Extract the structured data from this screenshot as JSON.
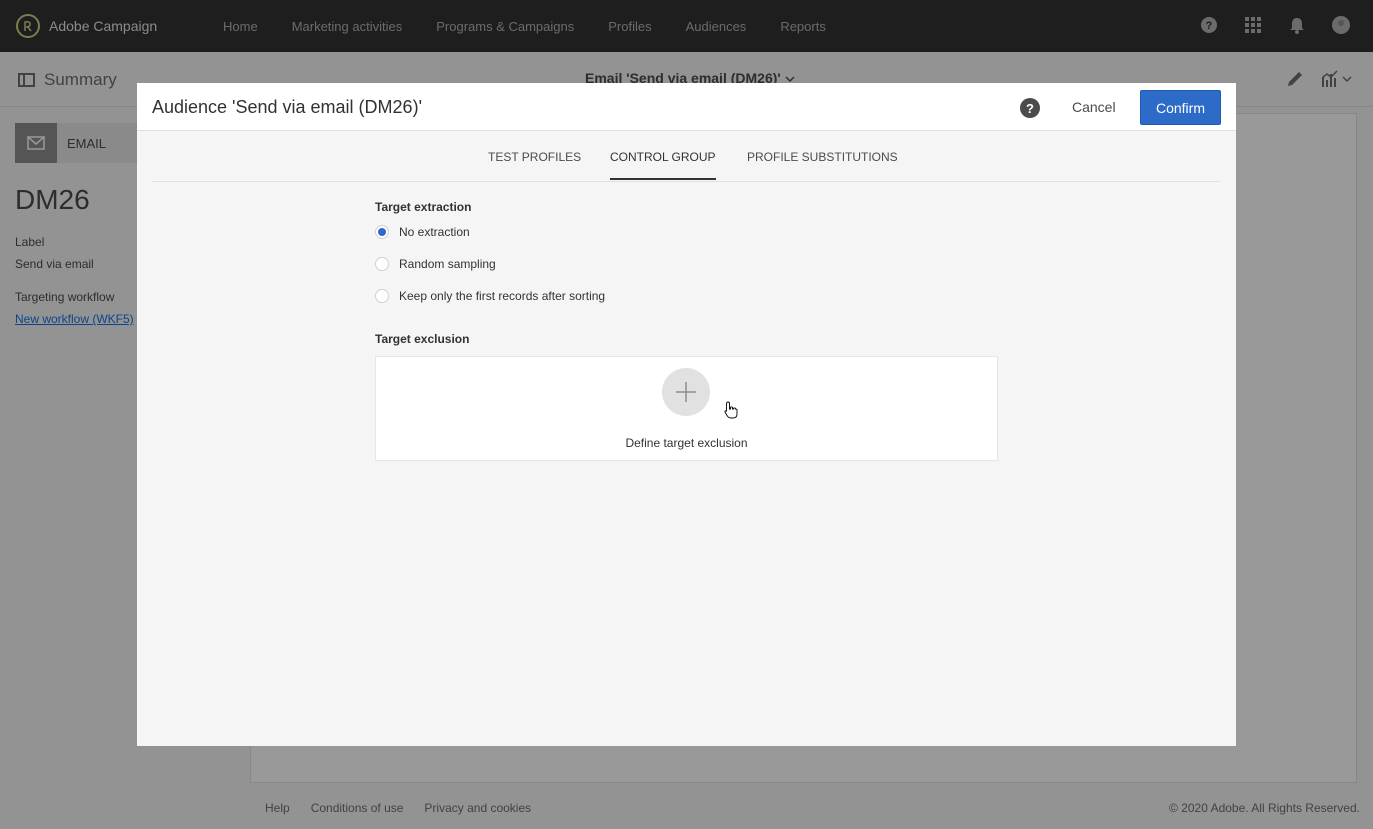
{
  "app": {
    "brand_name": "Adobe Campaign",
    "nav_items": [
      "Home",
      "Marketing activities",
      "Programs & Campaigns",
      "Profiles",
      "Audiences",
      "Reports"
    ]
  },
  "subbar": {
    "summary_label": "Summary",
    "title": "Email 'Send via email (DM26)'"
  },
  "left_panel": {
    "channel_label": "EMAIL",
    "delivery_id": "DM26",
    "label_caption": "Label",
    "label_value": "Send via email",
    "workflow_caption": "Targeting workflow",
    "workflow_link": "New workflow (WKF5)"
  },
  "footer": {
    "links": [
      "Help",
      "Conditions of use",
      "Privacy and cookies"
    ],
    "copyright": "© 2020 Adobe. All Rights Reserved."
  },
  "modal": {
    "title": "Audience 'Send via email (DM26)'",
    "help_label": "?",
    "cancel_label": "Cancel",
    "confirm_label": "Confirm",
    "tabs": [
      {
        "label": "TEST PROFILES",
        "active": false
      },
      {
        "label": "CONTROL GROUP",
        "active": true
      },
      {
        "label": "PROFILE SUBSTITUTIONS",
        "active": false
      }
    ],
    "target_extraction": {
      "title": "Target extraction",
      "options": [
        {
          "label": "No extraction",
          "checked": true
        },
        {
          "label": "Random sampling",
          "checked": false
        },
        {
          "label": "Keep only the first records after sorting",
          "checked": false
        }
      ]
    },
    "target_exclusion": {
      "title": "Target exclusion",
      "action_label": "Define target exclusion"
    }
  },
  "colors": {
    "topbar": "#323232",
    "accent": "#2d6bc8",
    "link": "#1473e6"
  }
}
